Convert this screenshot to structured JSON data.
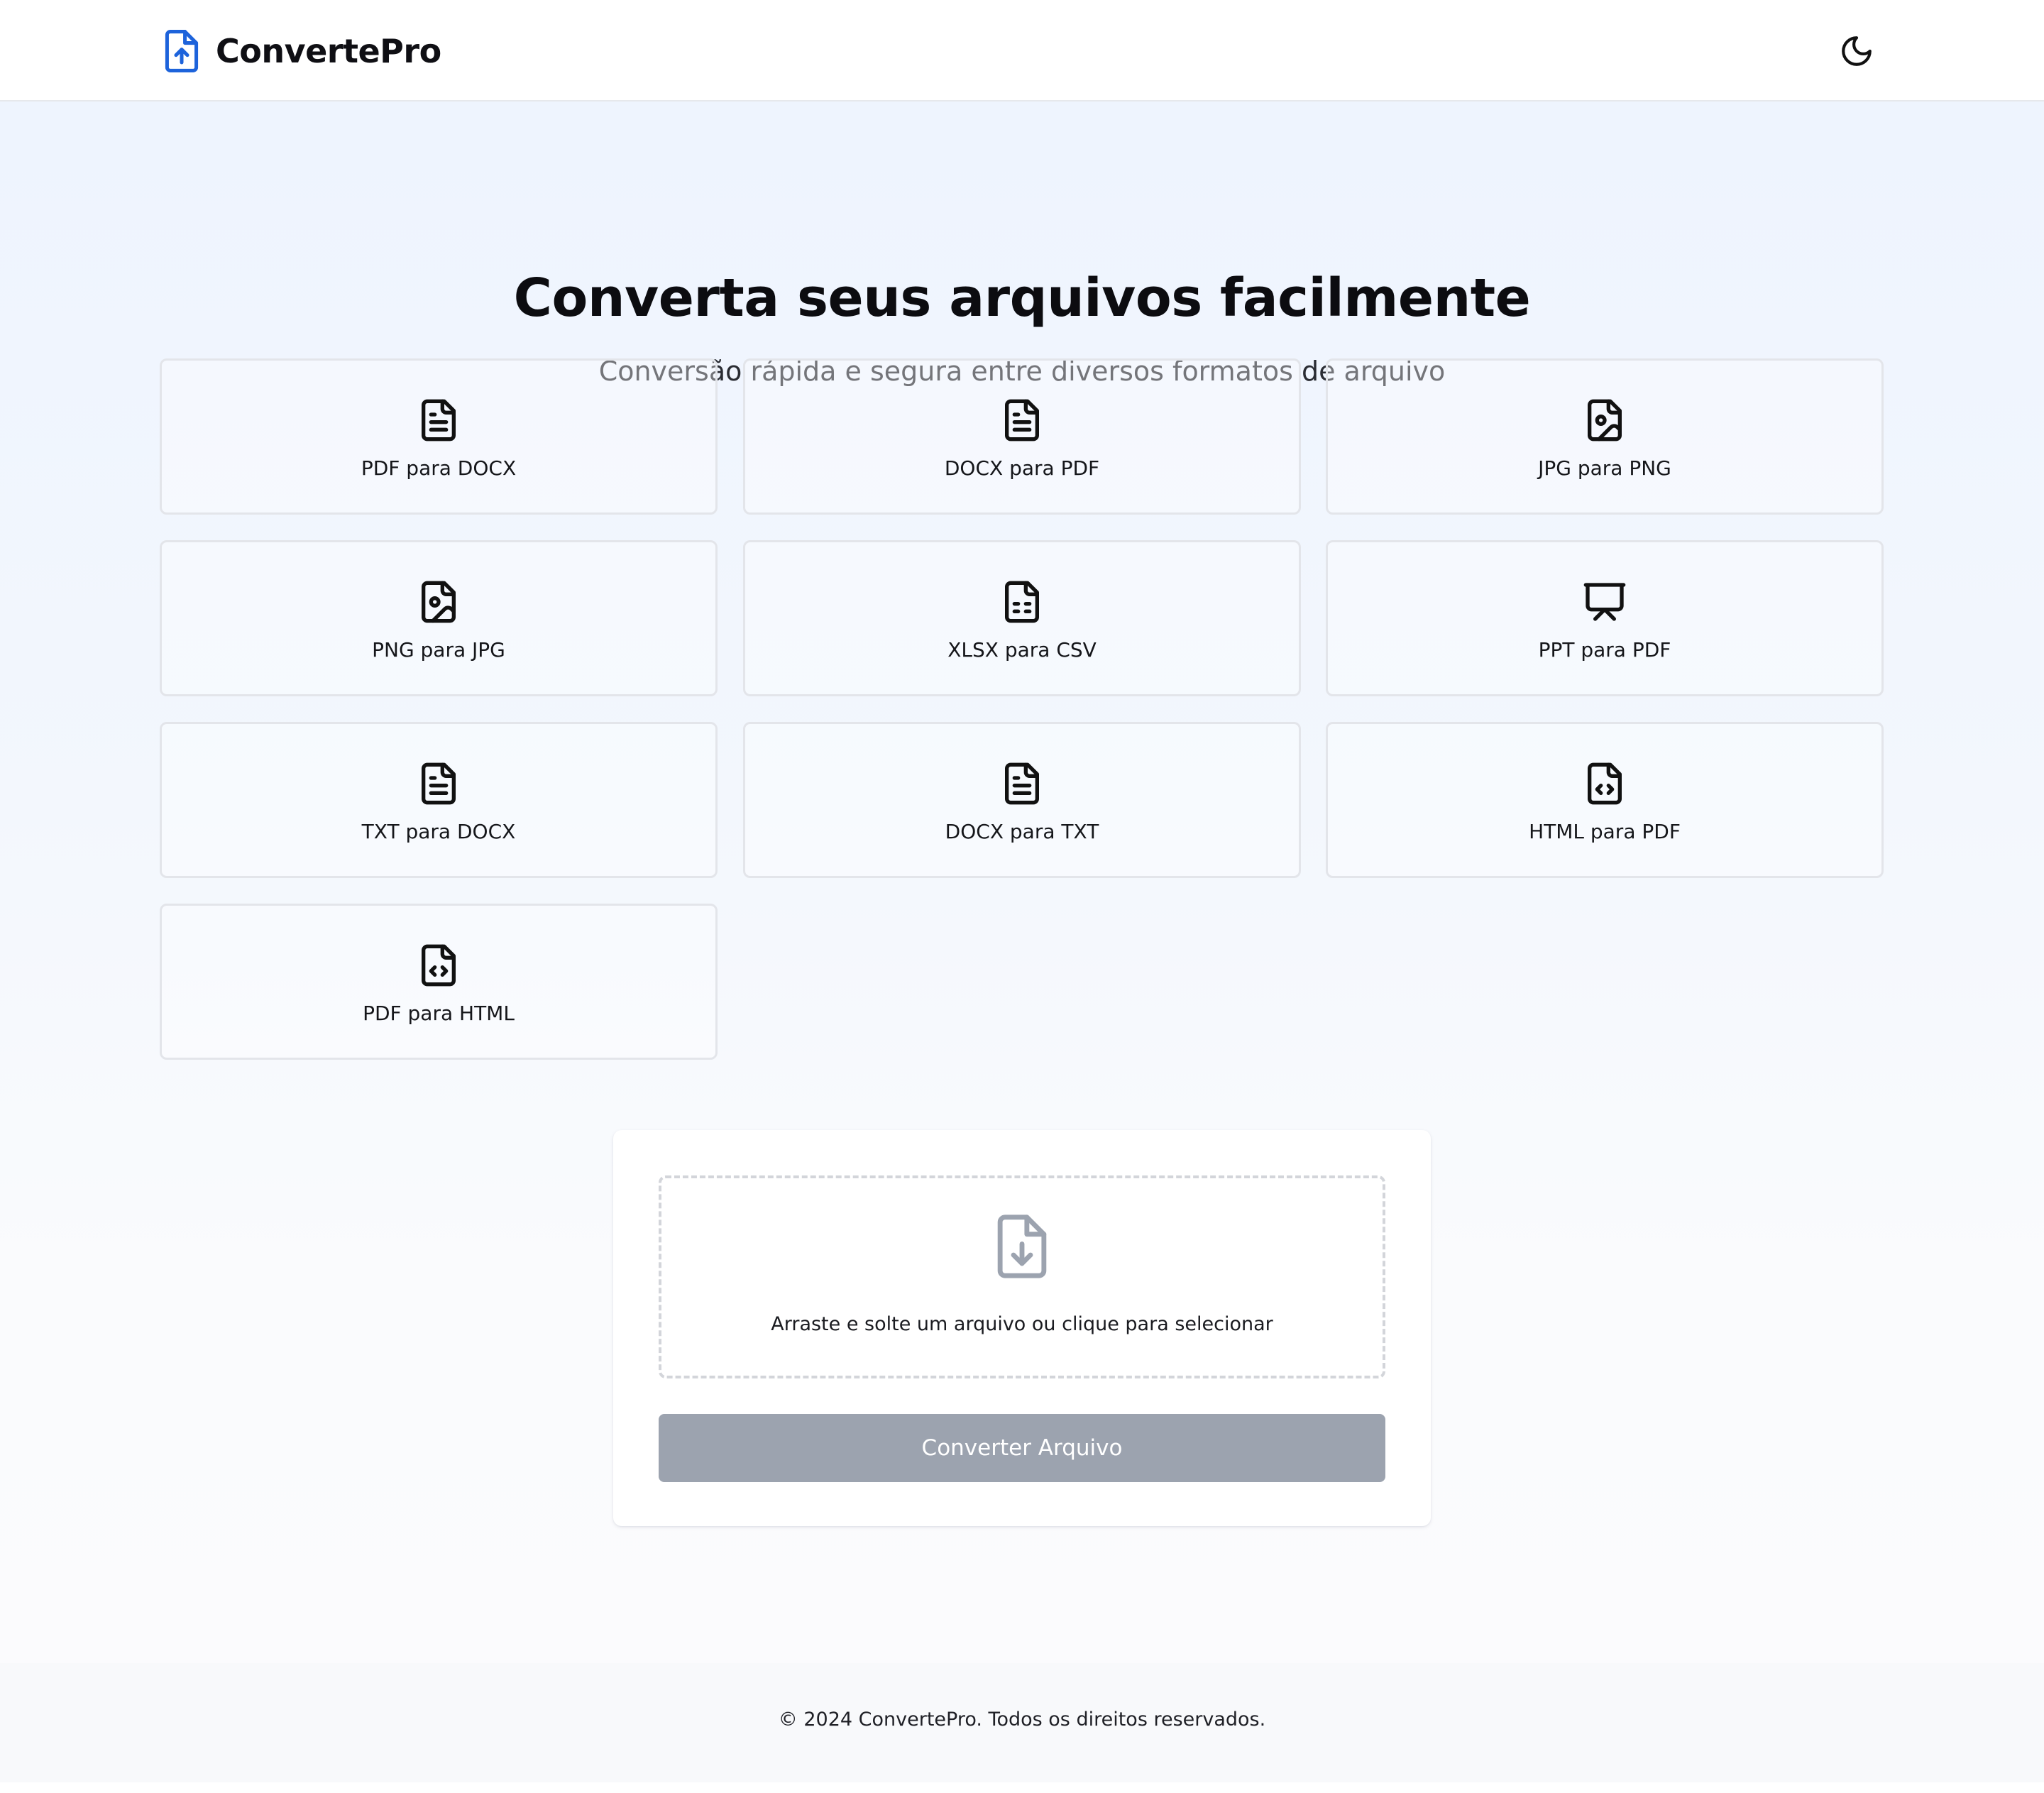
{
  "header": {
    "brand_name": "ConvertePro",
    "brand_icon": "file-upload-icon",
    "theme_toggle_icon": "moon-icon",
    "accent_color": "#1d63db"
  },
  "hero": {
    "title": "Converta seus arquivos facilmente",
    "subtitle": "Conversão rápida e segura entre diversos formatos de arquivo"
  },
  "conversions": [
    {
      "label": "PDF para DOCX",
      "icon": "file-text-icon"
    },
    {
      "label": "DOCX para PDF",
      "icon": "file-text-icon"
    },
    {
      "label": "JPG para PNG",
      "icon": "file-image-icon"
    },
    {
      "label": "PNG para JPG",
      "icon": "file-image-icon"
    },
    {
      "label": "XLSX para CSV",
      "icon": "file-spreadsheet-icon"
    },
    {
      "label": "PPT para PDF",
      "icon": "presentation-icon"
    },
    {
      "label": "TXT para DOCX",
      "icon": "file-text-icon"
    },
    {
      "label": "DOCX para TXT",
      "icon": "file-text-icon"
    },
    {
      "label": "HTML para PDF",
      "icon": "file-code-icon"
    },
    {
      "label": "PDF para HTML",
      "icon": "file-code-icon"
    }
  ],
  "upload": {
    "dropzone_text": "Arraste e solte um arquivo ou clique para selecionar",
    "dropzone_icon": "file-download-icon",
    "convert_button_label": "Converter Arquivo",
    "convert_button_disabled": true,
    "button_color": "#9ca3af"
  },
  "footer": {
    "text": "© 2024 ConvertePro. Todos os direitos reservados."
  }
}
